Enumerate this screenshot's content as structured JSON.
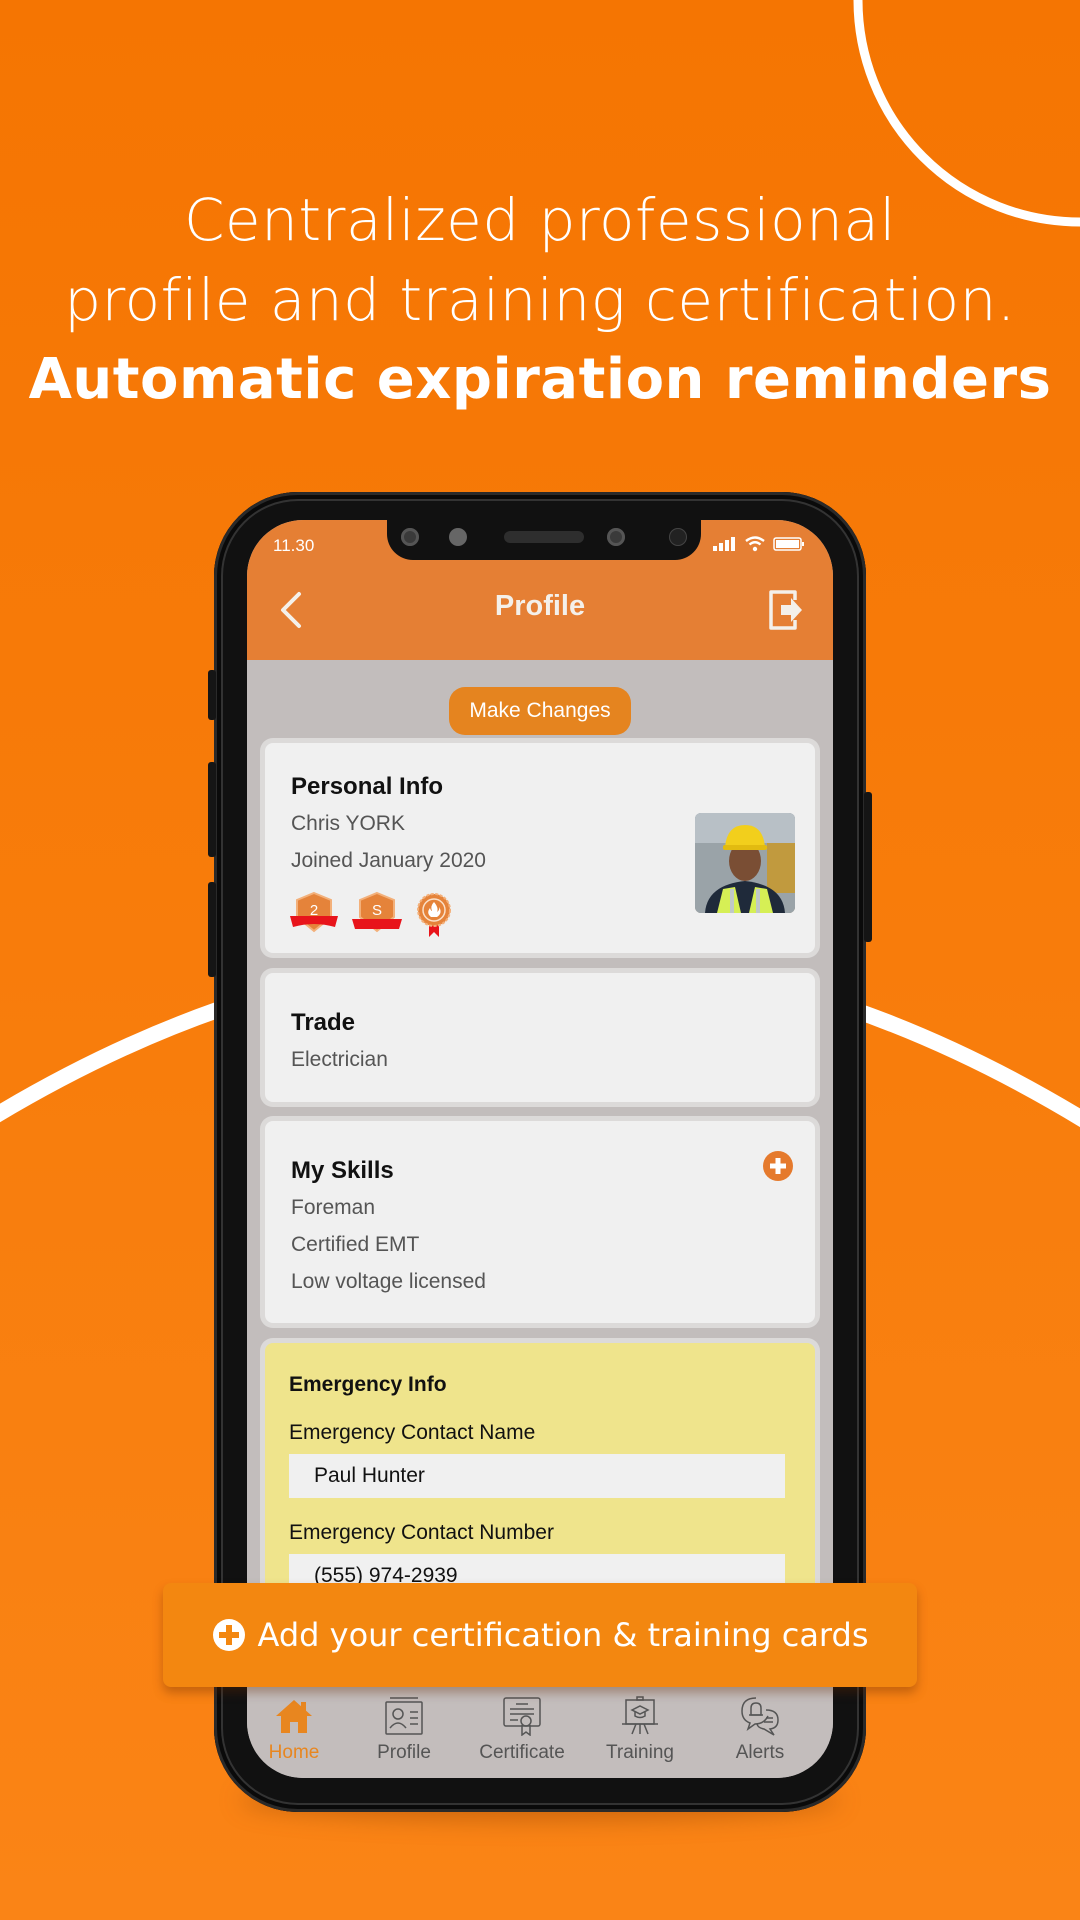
{
  "headline": {
    "line1": "Centralized professional",
    "line2": "profile and training certification.",
    "line3": "Automatic expiration reminders"
  },
  "status_bar": {
    "time": "11.30",
    "icons": [
      "signal-icon",
      "wifi-icon",
      "battery-icon"
    ]
  },
  "header": {
    "title": "Profile",
    "back_icon": "chevron-left-icon",
    "logout_icon": "logout-icon"
  },
  "make_changes_label": "Make Changes",
  "personal_info": {
    "title": "Personal Info",
    "name": "Chris YORK",
    "joined": "Joined January 2020",
    "badges": [
      {
        "type": "shield",
        "label": "2"
      },
      {
        "type": "shield",
        "label": "S"
      },
      {
        "type": "medal",
        "label": "flame"
      }
    ],
    "avatar_alt": "worker-with-hard-hat-photo"
  },
  "trade": {
    "title": "Trade",
    "value": "Electrician"
  },
  "skills": {
    "title": "My Skills",
    "items": [
      "Foreman",
      "Certified EMT",
      "Low voltage licensed"
    ]
  },
  "emergency": {
    "title": "Emergency Info",
    "name_label": "Emergency Contact Name",
    "name_value": "Paul Hunter",
    "number_label": "Emergency Contact Number",
    "number_value": "(555) 974-2939"
  },
  "banner": {
    "label": "Add your certification & training cards"
  },
  "tabs": [
    {
      "label": "Home",
      "icon": "home-icon",
      "active": true
    },
    {
      "label": "Profile",
      "icon": "id-card-icon",
      "active": false
    },
    {
      "label": "Certificate",
      "icon": "certificate-icon",
      "active": false
    },
    {
      "label": "Training",
      "icon": "training-board-icon",
      "active": false
    },
    {
      "label": "Alerts",
      "icon": "alert-bell-chat-icon",
      "active": false
    }
  ],
  "colors": {
    "background": "#f57502",
    "header": "#e57f34",
    "accent": "#e5841f",
    "emergency_card": "#efe48c",
    "banner": "#f38710",
    "badge_ribbon": "#e8141b"
  }
}
